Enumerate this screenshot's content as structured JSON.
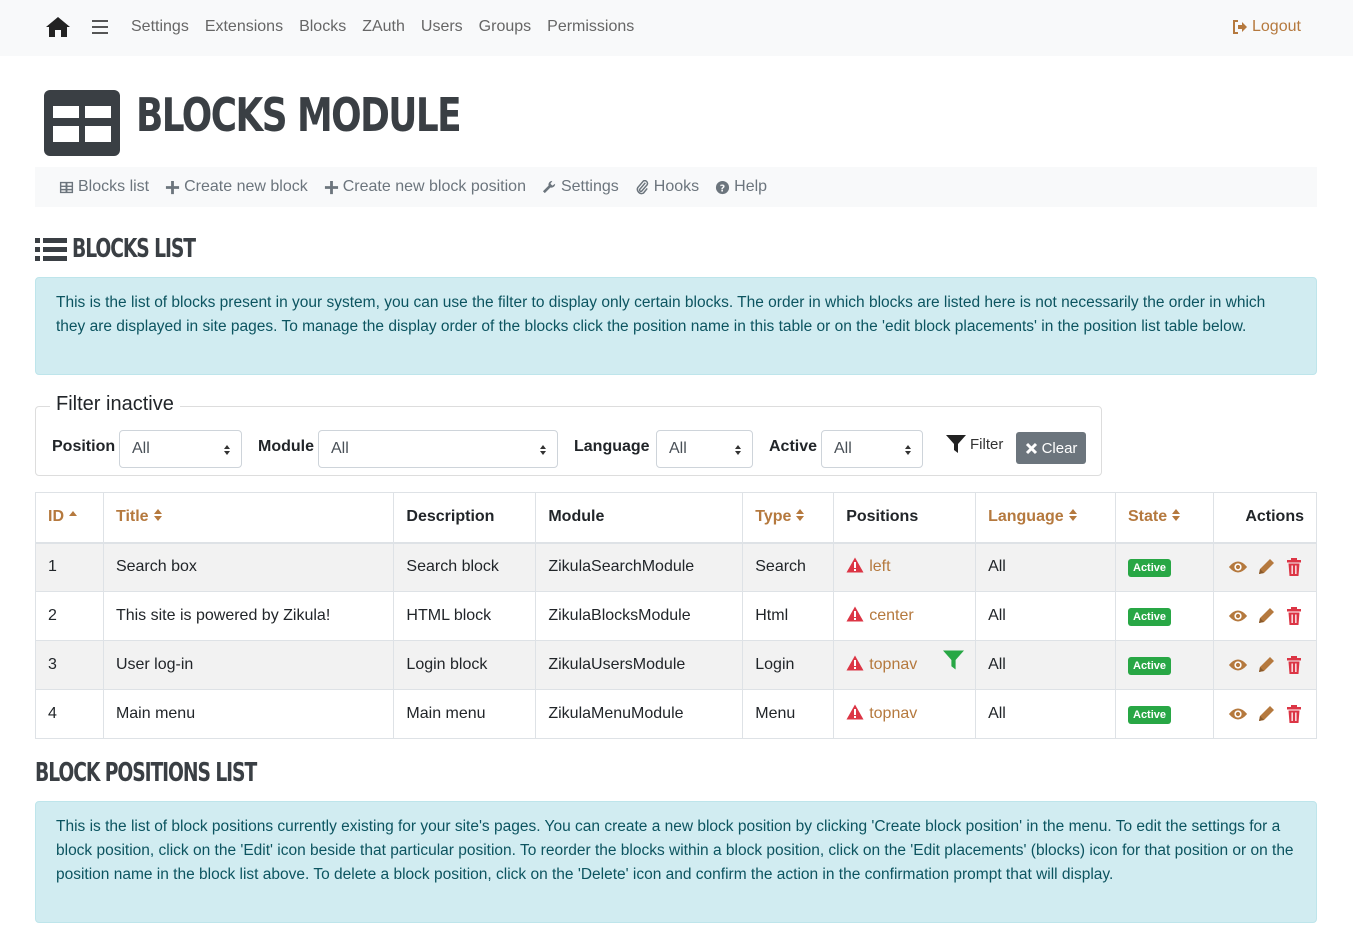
{
  "topnav": {
    "links": [
      "Settings",
      "Extensions",
      "Blocks",
      "ZAuth",
      "Users",
      "Groups",
      "Permissions"
    ],
    "logout": "Logout"
  },
  "header": {
    "title": "BLOCKS MODULE"
  },
  "submenu": {
    "blocks_list": "Blocks list",
    "create_block": "Create new block",
    "create_position": "Create new block position",
    "settings": "Settings",
    "hooks": "Hooks",
    "help": "Help"
  },
  "blocks_section": {
    "title": "BLOCKS LIST",
    "info": "This is the list of blocks present in your system, you can use the filter to display only certain blocks. The order in which blocks are listed here is not necessarily the order in which they are displayed in site pages. To manage the display order of the blocks click the position name in this table or on the 'edit block placements' in the position list table below."
  },
  "filter": {
    "legend": "Filter inactive",
    "position_label": "Position",
    "position_value": "All",
    "module_label": "Module",
    "module_value": "All",
    "language_label": "Language",
    "language_value": "All",
    "active_label": "Active",
    "active_value": "All",
    "filter_button": "Filter",
    "clear_button": "Clear"
  },
  "table": {
    "headers": {
      "id": "ID",
      "title": "Title",
      "description": "Description",
      "module": "Module",
      "type": "Type",
      "positions": "Positions",
      "language": "Language",
      "state": "State",
      "actions": "Actions"
    },
    "rows": [
      {
        "id": "1",
        "title": "Search box",
        "description": "Search block",
        "module": "ZikulaSearchModule",
        "type": "Search",
        "position": "left",
        "language": "All",
        "state": "Active"
      },
      {
        "id": "2",
        "title": "This site is powered by Zikula!",
        "description": "HTML block",
        "module": "ZikulaBlocksModule",
        "type": "Html",
        "position": "center",
        "language": "All",
        "state": "Active"
      },
      {
        "id": "3",
        "title": "User log-in",
        "description": "Login block",
        "module": "ZikulaUsersModule",
        "type": "Login",
        "position": "topnav",
        "language": "All",
        "state": "Active"
      },
      {
        "id": "4",
        "title": "Main menu",
        "description": "Main menu",
        "module": "ZikulaMenuModule",
        "type": "Menu",
        "position": "topnav",
        "language": "All",
        "state": "Active"
      }
    ]
  },
  "positions_section": {
    "title": "BLOCK POSITIONS LIST",
    "info": "This is the list of block positions currently existing for your site's pages. You can create a new block position by clicking 'Create block position' in the menu. To edit the settings for a block position, click on the 'Edit' icon beside that particular position. To reorder the blocks within a block position, click on the 'Edit placements' (blocks) icon for that position or on the position name in the block list above. To delete a block position, click on the 'Delete' icon and confirm the action in the confirmation prompt that will display."
  },
  "colors": {
    "accent": "#b5793e",
    "danger": "#dc3545",
    "success": "#28a745",
    "info_bg": "#d1ecf1"
  }
}
